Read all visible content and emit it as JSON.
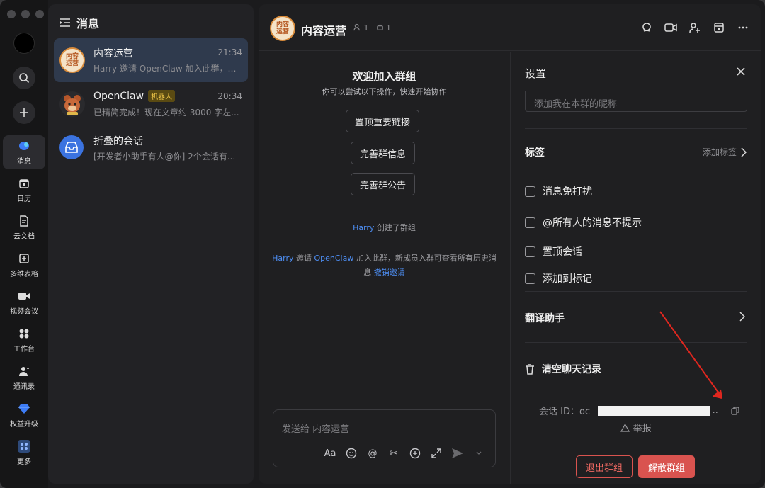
{
  "rail": {
    "items": [
      {
        "label": "消息",
        "icon": "message-icon",
        "active": true
      },
      {
        "label": "日历",
        "icon": "calendar-icon"
      },
      {
        "label": "云文档",
        "icon": "doc-icon"
      },
      {
        "label": "多维表格",
        "icon": "table-icon"
      },
      {
        "label": "视频会议",
        "icon": "video-icon"
      },
      {
        "label": "工作台",
        "icon": "apps-icon"
      },
      {
        "label": "通讯录",
        "icon": "contacts-icon"
      },
      {
        "label": "权益升级",
        "icon": "diamond-icon"
      },
      {
        "label": "更多",
        "icon": "more-icon"
      }
    ]
  },
  "list": {
    "title": "消息",
    "conversations": [
      {
        "name": "内容运营",
        "time": "21:34",
        "preview": "Harry 邀请 OpenClaw 加入此群，新...",
        "active": true
      },
      {
        "name": "OpenClaw",
        "badge": "机器人",
        "time": "20:34",
        "preview": "已精简完成！现在文章约 3000 字左..."
      },
      {
        "name": "折叠的会话",
        "time": "",
        "preview": "[开发者小助手有人@你] 2个会话有..."
      }
    ]
  },
  "header": {
    "group_avatar_line1": "内容",
    "group_avatar_line2": "运营",
    "group_name": "内容运营",
    "member_count": "1",
    "bot_count": "1"
  },
  "chat": {
    "welcome_title": "欢迎加入群组",
    "welcome_sub": "你可以尝试以下操作，快速开始协作",
    "actions": [
      "置顶重要链接",
      "完善群信息",
      "完善群公告"
    ],
    "sys1_user": "Harry",
    "sys1_text": " 创建了群组",
    "sys2_user": "Harry",
    "sys2_mid": " 邀请 ",
    "sys2_bot": "OpenClaw",
    "sys2_text": " 加入此群，新成员入群可查看所有历史消息 ",
    "sys2_link": "撤销邀请",
    "composer_placeholder": "发送给 内容运营"
  },
  "settings": {
    "title": "设置",
    "nickname_placeholder": "添加我在本群的昵称",
    "tags_label": "标签",
    "tags_action": "添加标签",
    "checks": [
      "消息免打扰",
      "@所有人的消息不提示",
      "置顶会话",
      "添加到标记"
    ],
    "translate_label": "翻译助手",
    "clear_label": "清空聊天记录",
    "conv_id_label": "会话 ID：oc_",
    "conv_id_tail": "..",
    "report_label": "举报",
    "exit_label": "退出群组",
    "dissolve_label": "解散群组"
  },
  "colors": {
    "accent": "#4e8ff5",
    "danger": "#d9534f",
    "annotation": "#e0271f"
  }
}
